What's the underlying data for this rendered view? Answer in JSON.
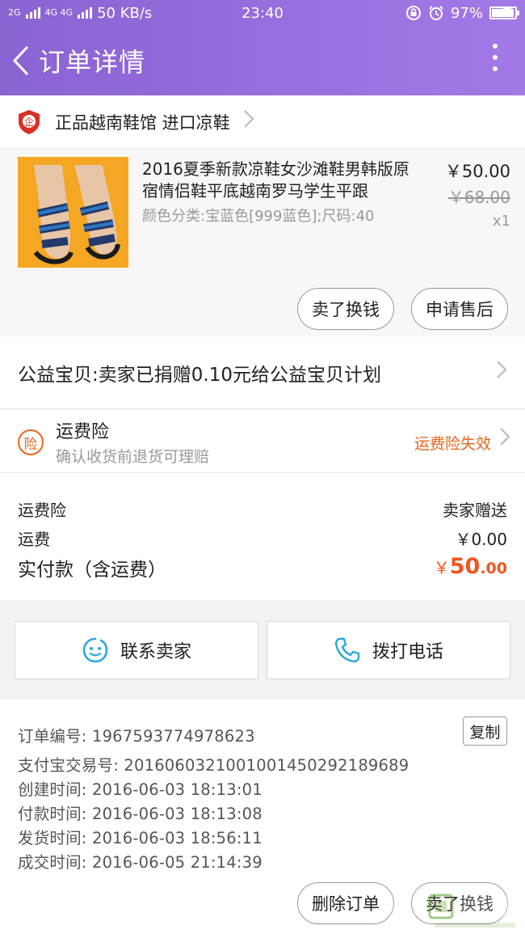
{
  "status_bar": {
    "network_left": "2G",
    "network_mid": "4G 4G",
    "speed": "50 KB/s",
    "time": "23:40",
    "battery": "97%",
    "battery_level": 0.97
  },
  "header": {
    "title": "订单详情"
  },
  "shop": {
    "name": "正品越南鞋馆 进口凉鞋",
    "badge_text": "企"
  },
  "item": {
    "name": "2016夏季新款凉鞋女沙滩鞋男韩版原宿情侣鞋平底越南罗马学生平跟",
    "spec": "颜色分类:宝蓝色[999蓝色];尺码:40",
    "price": "￥50.00",
    "original_price": "￥68.00",
    "quantity": "x1",
    "btn_sell": "卖了换钱",
    "btn_aftersale": "申请售后"
  },
  "charity": {
    "text": "公益宝贝:卖家已捐赠0.10元给公益宝贝计划"
  },
  "insurance": {
    "badge": "险",
    "title": "运费险",
    "subtitle": "确认收货前退货可理赔",
    "status": "运费险失效",
    "status_color": "#e8641a"
  },
  "cost": {
    "insurance_label": "运费险",
    "insurance_value": "卖家赠送",
    "shipping_label": "运费",
    "shipping_value": "￥0.00",
    "total_label": "实付款（含运费）",
    "total_symbol": "￥",
    "total_int": "50",
    "total_dec": ".00",
    "total_color": "#f1561f"
  },
  "actions": {
    "contact": "联系卖家",
    "call": "拨打电话"
  },
  "order": {
    "number": "订单编号: 1967593774978623",
    "copy": "复制",
    "alipay": "支付宝交易号: 2016060321001001450292189689",
    "created": "创建时间: 2016-06-03 18:13:01",
    "paid": "付款时间: 2016-06-03 18:13:08",
    "shipped": "发货时间: 2016-06-03 18:56:11",
    "completed": "成交时间: 2016-06-05 21:14:39",
    "btn_delete": "删除订单",
    "btn_sell": "卖了换钱"
  },
  "colors": {
    "header_purple": "#9b6fe0",
    "accent_orange": "#f1561f",
    "icon_blue": "#2aa7e0"
  }
}
